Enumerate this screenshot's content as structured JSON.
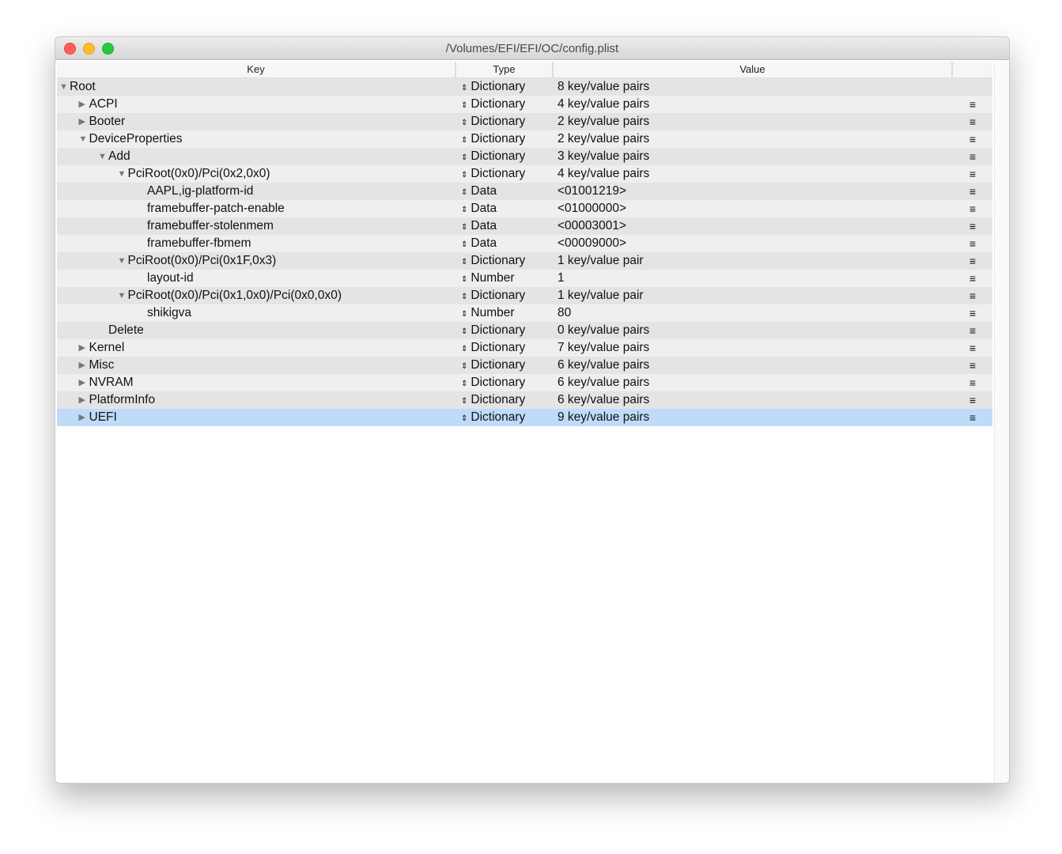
{
  "window": {
    "title": "/Volumes/EFI/EFI/OC/config.plist"
  },
  "columns": {
    "key": "Key",
    "type": "Type",
    "value": "Value"
  },
  "rows": [
    {
      "key": "Root",
      "type": "Dictionary",
      "value": "8 key/value pairs",
      "level": 0,
      "disclosure": "expanded",
      "menu": ""
    },
    {
      "key": "ACPI",
      "type": "Dictionary",
      "value": "4 key/value pairs",
      "level": 1,
      "disclosure": "collapsed",
      "menu": "≡"
    },
    {
      "key": "Booter",
      "type": "Dictionary",
      "value": "2 key/value pairs",
      "level": 1,
      "disclosure": "collapsed",
      "menu": "≡"
    },
    {
      "key": "DeviceProperties",
      "type": "Dictionary",
      "value": "2 key/value pairs",
      "level": 1,
      "disclosure": "expanded",
      "menu": "≡"
    },
    {
      "key": "Add",
      "type": "Dictionary",
      "value": "3 key/value pairs",
      "level": 2,
      "disclosure": "expanded",
      "menu": "≡"
    },
    {
      "key": "PciRoot(0x0)/Pci(0x2,0x0)",
      "type": "Dictionary",
      "value": "4 key/value pairs",
      "level": 3,
      "disclosure": "expanded",
      "menu": "≡"
    },
    {
      "key": "AAPL,ig-platform-id",
      "type": "Data",
      "value": "<01001219>",
      "level": 4,
      "disclosure": "none",
      "menu": "≡"
    },
    {
      "key": "framebuffer-patch-enable",
      "type": "Data",
      "value": "<01000000>",
      "level": 4,
      "disclosure": "none",
      "menu": "≡"
    },
    {
      "key": "framebuffer-stolenmem",
      "type": "Data",
      "value": "<00003001>",
      "level": 4,
      "disclosure": "none",
      "menu": "≡"
    },
    {
      "key": "framebuffer-fbmem",
      "type": "Data",
      "value": "<00009000>",
      "level": 4,
      "disclosure": "none",
      "menu": "≡"
    },
    {
      "key": "PciRoot(0x0)/Pci(0x1F,0x3)",
      "type": "Dictionary",
      "value": "1 key/value pair",
      "level": 3,
      "disclosure": "expanded",
      "menu": "≡"
    },
    {
      "key": "layout-id",
      "type": "Number",
      "value": "1",
      "level": 4,
      "disclosure": "none",
      "menu": "≡"
    },
    {
      "key": "PciRoot(0x0)/Pci(0x1,0x0)/Pci(0x0,0x0)",
      "type": "Dictionary",
      "value": "1 key/value pair",
      "level": 3,
      "disclosure": "expanded",
      "menu": "≡"
    },
    {
      "key": "shikigva",
      "type": "Number",
      "value": "80",
      "level": 4,
      "disclosure": "none",
      "menu": "≡"
    },
    {
      "key": "Delete",
      "type": "Dictionary",
      "value": "0 key/value pairs",
      "level": 2,
      "disclosure": "none",
      "menu": "≡"
    },
    {
      "key": "Kernel",
      "type": "Dictionary",
      "value": "7 key/value pairs",
      "level": 1,
      "disclosure": "collapsed",
      "menu": "≡"
    },
    {
      "key": "Misc",
      "type": "Dictionary",
      "value": "6 key/value pairs",
      "level": 1,
      "disclosure": "collapsed",
      "menu": "≡"
    },
    {
      "key": "NVRAM",
      "type": "Dictionary",
      "value": "6 key/value pairs",
      "level": 1,
      "disclosure": "collapsed",
      "menu": "≡"
    },
    {
      "key": "PlatformInfo",
      "type": "Dictionary",
      "value": "6 key/value pairs",
      "level": 1,
      "disclosure": "collapsed",
      "menu": "≡"
    },
    {
      "key": "UEFI",
      "type": "Dictionary",
      "value": "9 key/value pairs",
      "level": 1,
      "disclosure": "collapsed",
      "menu": "≡",
      "selected": true
    }
  ]
}
